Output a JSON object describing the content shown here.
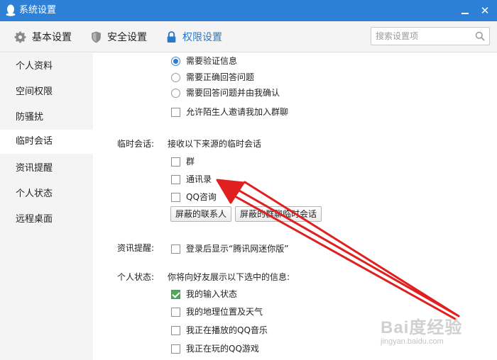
{
  "window": {
    "title": "系统设置",
    "close_glyph": "✕"
  },
  "toolbar": {
    "tabs": [
      {
        "label": "基本设置",
        "icon": "gear-icon"
      },
      {
        "label": "安全设置",
        "icon": "shield-icon"
      },
      {
        "label": "权限设置",
        "icon": "lock-icon",
        "active": true
      }
    ],
    "search": {
      "placeholder": "搜索设置项",
      "value": ""
    }
  },
  "sidebar": {
    "items": [
      {
        "label": "个人资料"
      },
      {
        "label": "空间权限"
      },
      {
        "label": "防骚扰"
      },
      {
        "label": "临时会话",
        "active": true
      },
      {
        "label": "资讯提醒"
      },
      {
        "label": "个人状态"
      },
      {
        "label": "远程桌面"
      }
    ]
  },
  "main": {
    "verify": {
      "options": [
        {
          "label": "需要验证信息",
          "selected": true
        },
        {
          "label": "需要正确回答问题",
          "selected": false
        },
        {
          "label": "需要回答问题并由我确认",
          "selected": false
        }
      ],
      "group_invite": {
        "label": "允许陌生人邀请我加入群聊",
        "checked": false
      }
    },
    "temp_session": {
      "label": "临时会话:",
      "description": "接收以下来源的临时会话",
      "options": [
        {
          "label": "群",
          "checked": false
        },
        {
          "label": "通讯录",
          "checked": false
        },
        {
          "label": "QQ咨询",
          "checked": false
        }
      ],
      "buttons": [
        "屏蔽的联系人",
        "屏蔽的群聊临时会话"
      ]
    },
    "news": {
      "label": "资讯提醒:",
      "option": {
        "label": "登录后显示“腾讯网迷你版”",
        "checked": false
      }
    },
    "status": {
      "label": "个人状态:",
      "description": "你将向好友展示以下选中的信息:",
      "options": [
        {
          "label": "我的输入状态",
          "checked": true
        },
        {
          "label": "我的地理位置及天气",
          "checked": false
        },
        {
          "label": "我正在播放的QQ音乐",
          "checked": false
        },
        {
          "label": "我正在玩的QQ游戏",
          "checked": false
        }
      ]
    }
  },
  "watermark": {
    "logo": "Bai度经验",
    "url": "jingyan.baidu.com"
  },
  "colors": {
    "titlebar": "#2e7fd6",
    "accent": "#2a78c8",
    "check_green": "#4bab55",
    "arrow": "#e02020"
  }
}
